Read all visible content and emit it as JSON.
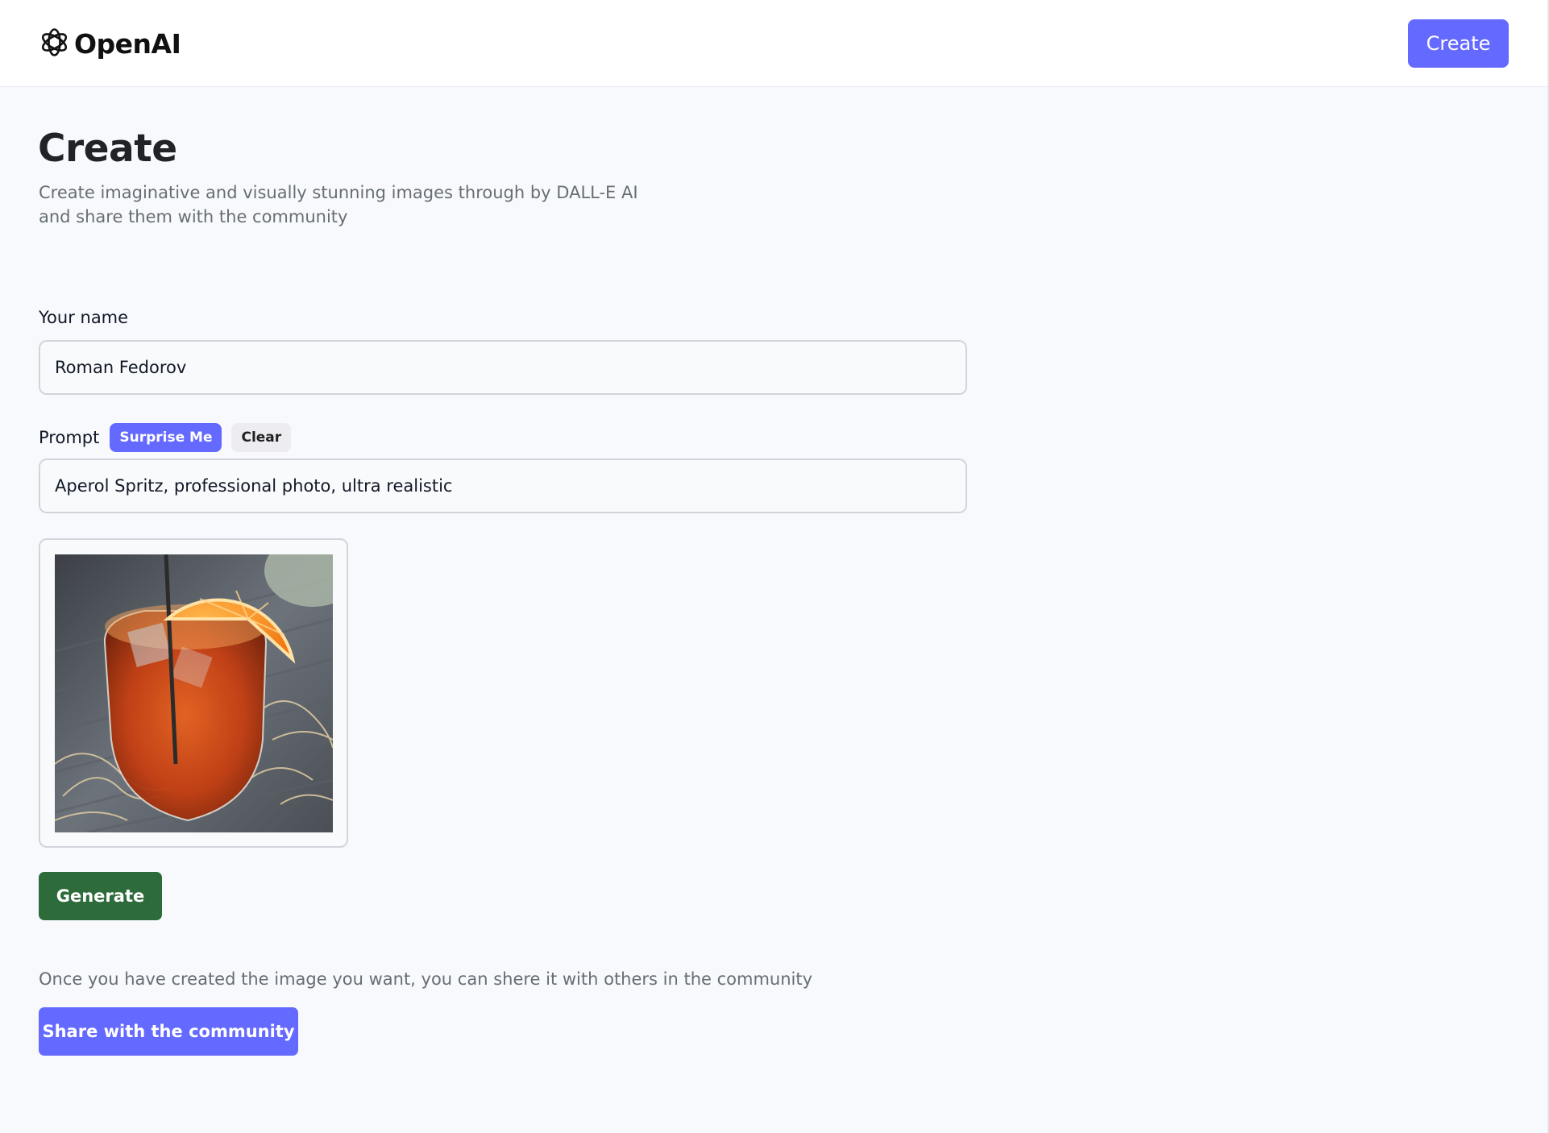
{
  "header": {
    "logo_text": "OpenAI",
    "logo_icon": "openai-logo-icon",
    "create_button_label": "Create"
  },
  "main": {
    "title": "Create",
    "description": "Create imaginative and visually stunning images through by DALL-E AI and share them with the community"
  },
  "form": {
    "name_label": "Your name",
    "name_value": "Roman Fedorov",
    "prompt_label": "Prompt",
    "surprise_label": "Surprise Me",
    "clear_label": "Clear",
    "prompt_value": "Aperol Spritz, professional photo, ultra realistic",
    "generated_image": "aperol-spritz-photo",
    "generate_label": "Generate"
  },
  "share": {
    "hint": "Once you have created the image you want, you can shere it with others in the community",
    "button_label": "Share with the community"
  },
  "colors": {
    "accent": "#6469ff",
    "generate": "#2e6b3b",
    "background": "#f8f9fc"
  }
}
